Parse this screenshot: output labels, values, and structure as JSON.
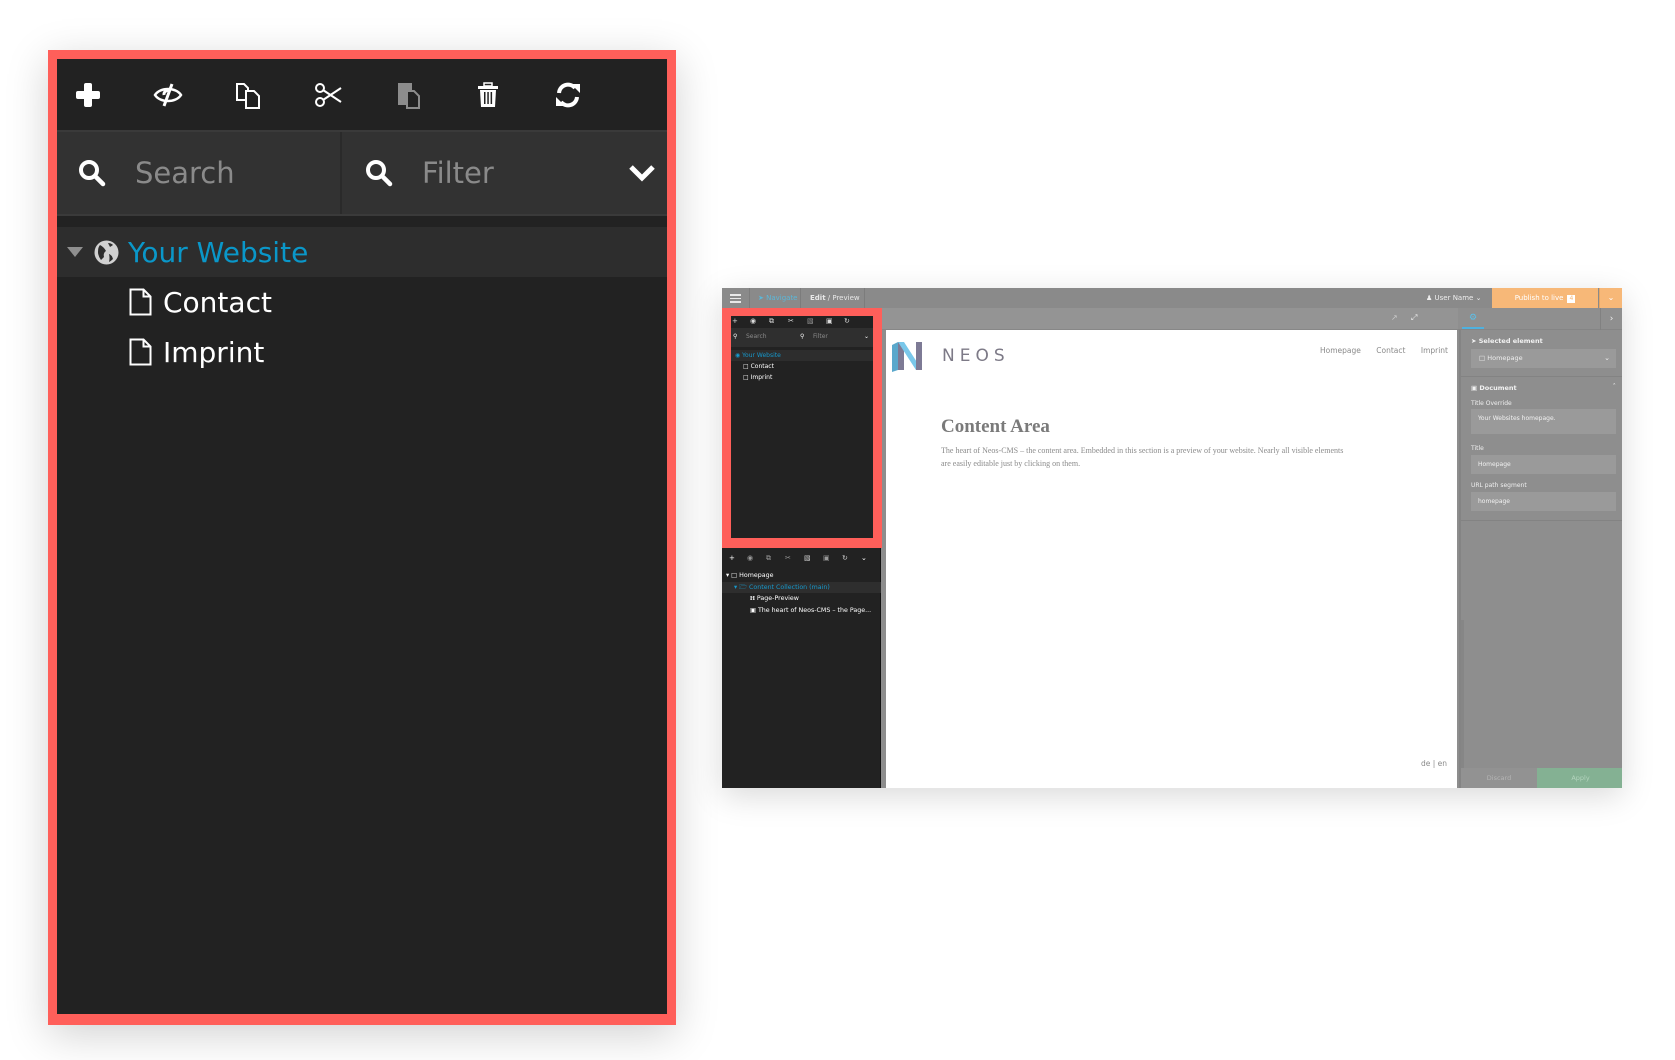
{
  "colors": {
    "highlight": "#ff5f5a",
    "panel_bg": "#222222",
    "accent_blue": "#0a97c9",
    "publish_orange": "#f7b878",
    "apply_green": "#84b193"
  },
  "zoomed_panel": {
    "toolbar": [
      {
        "name": "add-icon",
        "glyph": "plus"
      },
      {
        "name": "hide-icon",
        "glyph": "eye-slash"
      },
      {
        "name": "copy-icon",
        "glyph": "copy"
      },
      {
        "name": "cut-icon",
        "glyph": "scissors"
      },
      {
        "name": "paste-icon",
        "glyph": "paste",
        "disabled": true
      },
      {
        "name": "delete-icon",
        "glyph": "trash"
      },
      {
        "name": "refresh-icon",
        "glyph": "refresh"
      }
    ],
    "search_placeholder": "Search",
    "filter_placeholder": "Filter",
    "tree": {
      "root": "Your Website",
      "children": [
        "Contact",
        "Imprint"
      ]
    }
  },
  "app": {
    "topbar": {
      "navigate": "Navigate",
      "edit": "Edit",
      "preview": " / Preview",
      "user": "User Name",
      "publish": "Publish to live",
      "publish_count": "4"
    },
    "left_tree": {
      "search": "Search",
      "filter": "Filter",
      "root": "Your Website",
      "children": [
        "Contact",
        "Imprint"
      ]
    },
    "content_tree": [
      {
        "label": "Homepage",
        "icon": "document"
      },
      {
        "label": "Content Collection (main)",
        "icon": "folder-open",
        "selected": true
      },
      {
        "label": "Page-Preview",
        "icon": "heading"
      },
      {
        "label": "The heart of Neos-CMS – the Page...",
        "icon": "text-file"
      }
    ],
    "website": {
      "logo_text": "NEOS",
      "nav": [
        "Homepage",
        "Contact",
        "Imprint"
      ],
      "heading": "Content Area",
      "body": "The heart of Neos-CMS – the content area. Embedded in this section is a preview of your website. Nearly all visible elements are easily editable just by clicking on them.",
      "lang": "de | en"
    },
    "inspector": {
      "selected_label": "Selected element",
      "selected_value": "Homepage",
      "section": "Document",
      "fields": [
        {
          "label": "Title Override",
          "value": "Your Websites homepage."
        },
        {
          "label": "Title",
          "value": "Homepage"
        },
        {
          "label": "URL path segment",
          "value": "homepage"
        }
      ],
      "discard": "Discard",
      "apply": "Apply"
    }
  }
}
